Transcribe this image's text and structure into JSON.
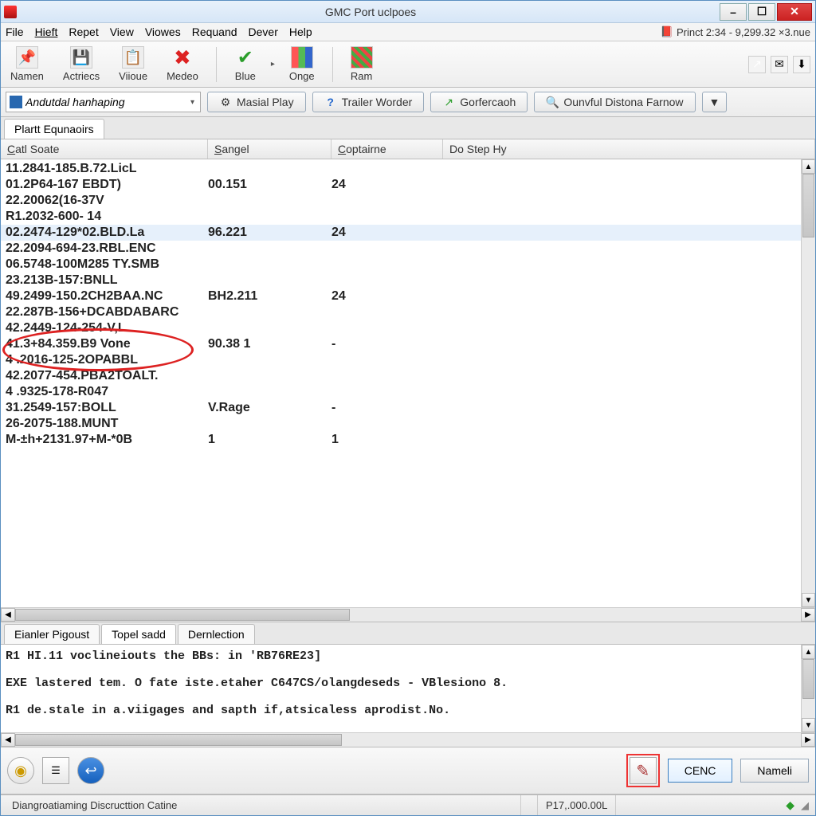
{
  "window": {
    "title": "GMC Port uclpoes"
  },
  "menubar": {
    "items": [
      "File",
      "Hieft",
      "Repet",
      "View",
      "Viowes",
      "Requand",
      "Dever",
      "Help"
    ],
    "right_icon": "📕",
    "right_text": "Princt 2:34 - 9,299.32 ×3.nue"
  },
  "toolbar": {
    "buttons": [
      {
        "label": "Namen",
        "icon": "📌"
      },
      {
        "label": "Actriecs",
        "icon": "💾"
      },
      {
        "label": "Viioue",
        "icon": "📋"
      },
      {
        "label": "Medeo",
        "icon": "✖"
      }
    ],
    "buttons2": [
      {
        "label": "Blue",
        "icon": "✔"
      },
      {
        "label": "Onge",
        "icon": "▦"
      }
    ],
    "buttons3": [
      {
        "label": "Ram",
        "icon": "▤"
      }
    ],
    "small_icons": [
      "↗",
      "✉",
      "⬇"
    ]
  },
  "actionbar": {
    "combo_value": "Andutdal hanhaping",
    "buttons": [
      {
        "label": "Masial Play",
        "icon": "⚙"
      },
      {
        "label": "Trailer Worder",
        "icon": "?"
      },
      {
        "label": "Gorfercaoh",
        "icon": "↗"
      },
      {
        "label": "Ounvful Distona Farnow",
        "icon": "🔍"
      }
    ],
    "dropdown": "▼"
  },
  "upper_tab": "Plartt Equnaoirs",
  "columns": {
    "c1": "Catl Soate",
    "c2": "Sangel",
    "c3": "Coptairne",
    "c4": "Do Step Hy"
  },
  "rows": [
    {
      "c1": "11.2841-185.B.72.LicL",
      "c2": "",
      "c3": "",
      "c4": ""
    },
    {
      "c1": "01.2P64-167 EBDT)",
      "c2": "00.151",
      "c3": "24",
      "c4": ""
    },
    {
      "c1": "22.20062(16-37V",
      "c2": "",
      "c3": "",
      "c4": ""
    },
    {
      "c1": "R1.2032-600- 14",
      "c2": "",
      "c3": "",
      "c4": ""
    },
    {
      "c1": "02.2474-129*02.BLD.La",
      "c2": "96.221",
      "c3": "24",
      "c4": "",
      "sel": true
    },
    {
      "c1": "22.2094-694-23.RBL.ENC",
      "c2": "",
      "c3": "",
      "c4": ""
    },
    {
      "c1": "06.5748-100M285 TY.SMB",
      "c2": "",
      "c3": "",
      "c4": ""
    },
    {
      "c1": "23.213B-157:BNLL",
      "c2": "",
      "c3": "",
      "c4": ""
    },
    {
      "c1": "49.2499-150.2CH2BAA.NC",
      "c2": "BH2.211",
      "c3": "24",
      "c4": ""
    },
    {
      "c1": "22.287B-156+DCABDABARC",
      "c2": "",
      "c3": "",
      "c4": ""
    },
    {
      "c1": "42.2449-124-254-V,L",
      "c2": "",
      "c3": "",
      "c4": ""
    },
    {
      "c1": "41.3+84.359.B9 Vone",
      "c2": "90.38 1",
      "c3": "-",
      "c4": ""
    },
    {
      "c1": "4 .2016-125-2OPABBL",
      "c2": "",
      "c3": "",
      "c4": ""
    },
    {
      "c1": "42.2077-454.PBA2TOALT.",
      "c2": "",
      "c3": "",
      "c4": ""
    },
    {
      "c1": "4 .9325-178-R047",
      "c2": "",
      "c3": "",
      "c4": ""
    },
    {
      "c1": "31.2549-157:BOLL",
      "c2": "V.Rage",
      "c3": "-",
      "c4": ""
    },
    {
      "c1": "26-2075-188.MUNT",
      "c2": "",
      "c3": "",
      "c4": ""
    },
    {
      "c1": "M-±h+2131.97+M-*0B",
      "c2": "1",
      "c3": "1",
      "c4": ""
    }
  ],
  "bottom_tabs": [
    "Eianler Pigoust",
    "Topel sadd",
    "Dernlection"
  ],
  "bottom_active": 1,
  "log_lines": [
    "R1 HI.11 voclineiouts the BBs: in 'RB76RE23]",
    "",
    "EXE lastered tem. O fate iste.etaher C647CS/olangdeseds - VBlesiono 8.",
    "",
    "R1 de.stale in a.viigages and sapth if,atsicaless aprodist.No."
  ],
  "footer_buttons": {
    "pen_icon": "✎",
    "primary": "CENC",
    "secondary": "Nameli"
  },
  "status": {
    "left": "Diangroatiaming Discructtion Catine",
    "right": "P17,.000.00L"
  }
}
